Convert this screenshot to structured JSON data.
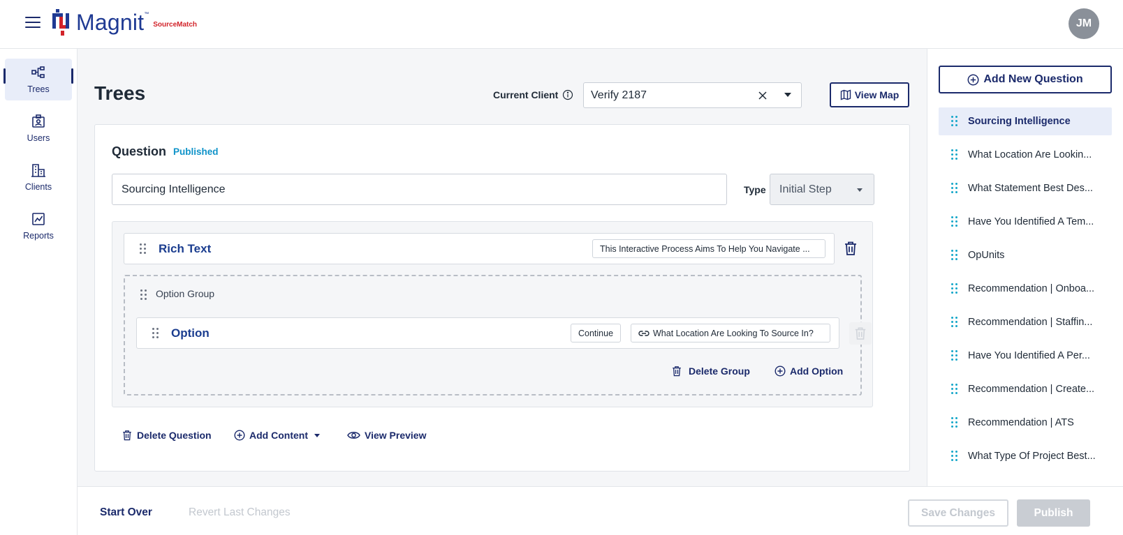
{
  "header": {
    "brand": "Magnit",
    "brand_tm": "™",
    "brand_sub": "SourceMatch",
    "avatar_initials": "JM"
  },
  "nav": {
    "items": [
      {
        "label": "Trees",
        "icon": "tree-icon",
        "active": true
      },
      {
        "label": "Users",
        "icon": "users-icon",
        "active": false
      },
      {
        "label": "Clients",
        "icon": "clients-icon",
        "active": false
      },
      {
        "label": "Reports",
        "icon": "reports-icon",
        "active": false
      }
    ]
  },
  "page": {
    "title": "Trees",
    "client_label": "Current Client",
    "client_value": "Verify 2187",
    "view_map_label": "View Map"
  },
  "question": {
    "title": "Question",
    "status": "Published",
    "name_value": "Sourcing Intelligence",
    "type_label": "Type",
    "type_value": "Initial Step",
    "rich_text": {
      "title": "Rich Text",
      "preview": "This Interactive Process Aims To Help You Navigate ..."
    },
    "option_group": {
      "label": "Option Group",
      "option": {
        "title": "Option",
        "action": "Continue",
        "link": "What Location Are Looking To Source In?"
      },
      "delete_group_label": "Delete Group",
      "add_option_label": "Add Option"
    },
    "actions": {
      "delete_label": "Delete Question",
      "add_content_label": "Add Content",
      "view_preview_label": "View Preview"
    }
  },
  "footer": {
    "start_over": "Start Over",
    "revert": "Revert Last Changes",
    "save": "Save Changes",
    "publish": "Publish"
  },
  "rightpanel": {
    "add_label": "Add New Question",
    "questions": [
      "Sourcing Intelligence",
      "What Location Are Lookin...",
      "What Statement Best Des...",
      "Have You Identified A Tem...",
      "OpUnits",
      "Recommendation | Onboa...",
      "Recommendation | Staffin...",
      "Have You Identified A Per...",
      "Recommendation | Create...",
      "Recommendation | ATS",
      "What Type Of Project Best..."
    ]
  },
  "colors": {
    "primary": "#1b2a6b",
    "accent": "#0f93c9",
    "brand_red": "#d2232a"
  }
}
